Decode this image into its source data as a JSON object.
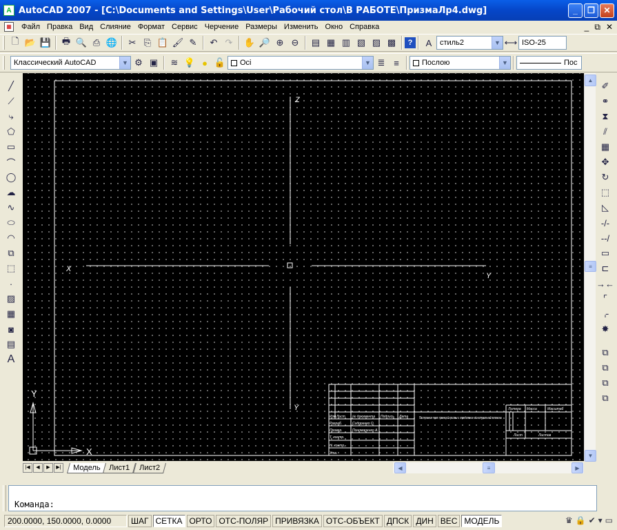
{
  "window": {
    "title": "AutoCAD 2007 - [C:\\Documents and Settings\\User\\Рабочий стол\\В РАБОТЕ\\ПризмаЛр4.dwg]",
    "app_icon": "autocad-app-icon",
    "buttons": [
      "_",
      "❐",
      "✕"
    ]
  },
  "menu": {
    "items": [
      "Файл",
      "Правка",
      "Вид",
      "Слияние",
      "Формат",
      "Сервис",
      "Черчение",
      "Размеры",
      "Изменить",
      "Окно",
      "Справка"
    ],
    "doc_controls": [
      "_",
      "⧉",
      "✕"
    ]
  },
  "toolbar_standard": {
    "text_style": "стиль2",
    "dim_style": "ISO-25"
  },
  "toolbar_layers": {
    "workspace": "Классический AutoCAD",
    "layer": "Осi",
    "color": "Послою",
    "linetype": "Пос"
  },
  "drawing": {
    "axis_labels": {
      "z": "Z",
      "x": "X",
      "y_right": "Y",
      "y_bottom": "Y"
    },
    "ucs_labels": {
      "x": "X",
      "y": "Y"
    },
    "title_block": {
      "header_cells": [
        "Изм.",
        "Лист",
        "№ документа",
        "Подпись",
        "Дата"
      ],
      "rows": [
        {
          "role": "Разраб.",
          "name": "Сидоренко О."
        },
        {
          "role": "Провер.",
          "name": "Пономаренко А."
        },
        {
          "role": "Т. контр.",
          "name": ""
        },
        {
          "role": "Н. контр.",
          "name": ""
        },
        {
          "role": "Утв.",
          "name": ""
        }
      ],
      "drawing_name": "Построение трех проекций призмы и определение её натуральной величины",
      "lit_header": [
        "Литера",
        "Масса",
        "Масштаб"
      ],
      "sheet_label": "Лист",
      "sheets_label": "Листов"
    }
  },
  "layout_tabs": {
    "nav": [
      "|◀",
      "◀",
      "▶",
      "▶|"
    ],
    "tabs": [
      "Модель",
      "Лист1",
      "Лист2"
    ],
    "active": "Модель"
  },
  "command": {
    "prompt": "Команда:"
  },
  "status": {
    "coords": "200.0000, 150.0000, 0.0000",
    "toggles": [
      {
        "label": "ШАГ",
        "on": false
      },
      {
        "label": "СЕТКА",
        "on": true
      },
      {
        "label": "ОРТО",
        "on": false
      },
      {
        "label": "ОТС-ПОЛЯР",
        "on": false
      },
      {
        "label": "ПРИВЯЗКА",
        "on": false
      },
      {
        "label": "ОТС-ОБЪЕКТ",
        "on": false
      },
      {
        "label": "ДПСК",
        "on": false
      },
      {
        "label": "ДИН",
        "on": false
      },
      {
        "label": "ВЕС",
        "on": false
      },
      {
        "label": "МОДЕЛЬ",
        "on": true
      }
    ]
  }
}
